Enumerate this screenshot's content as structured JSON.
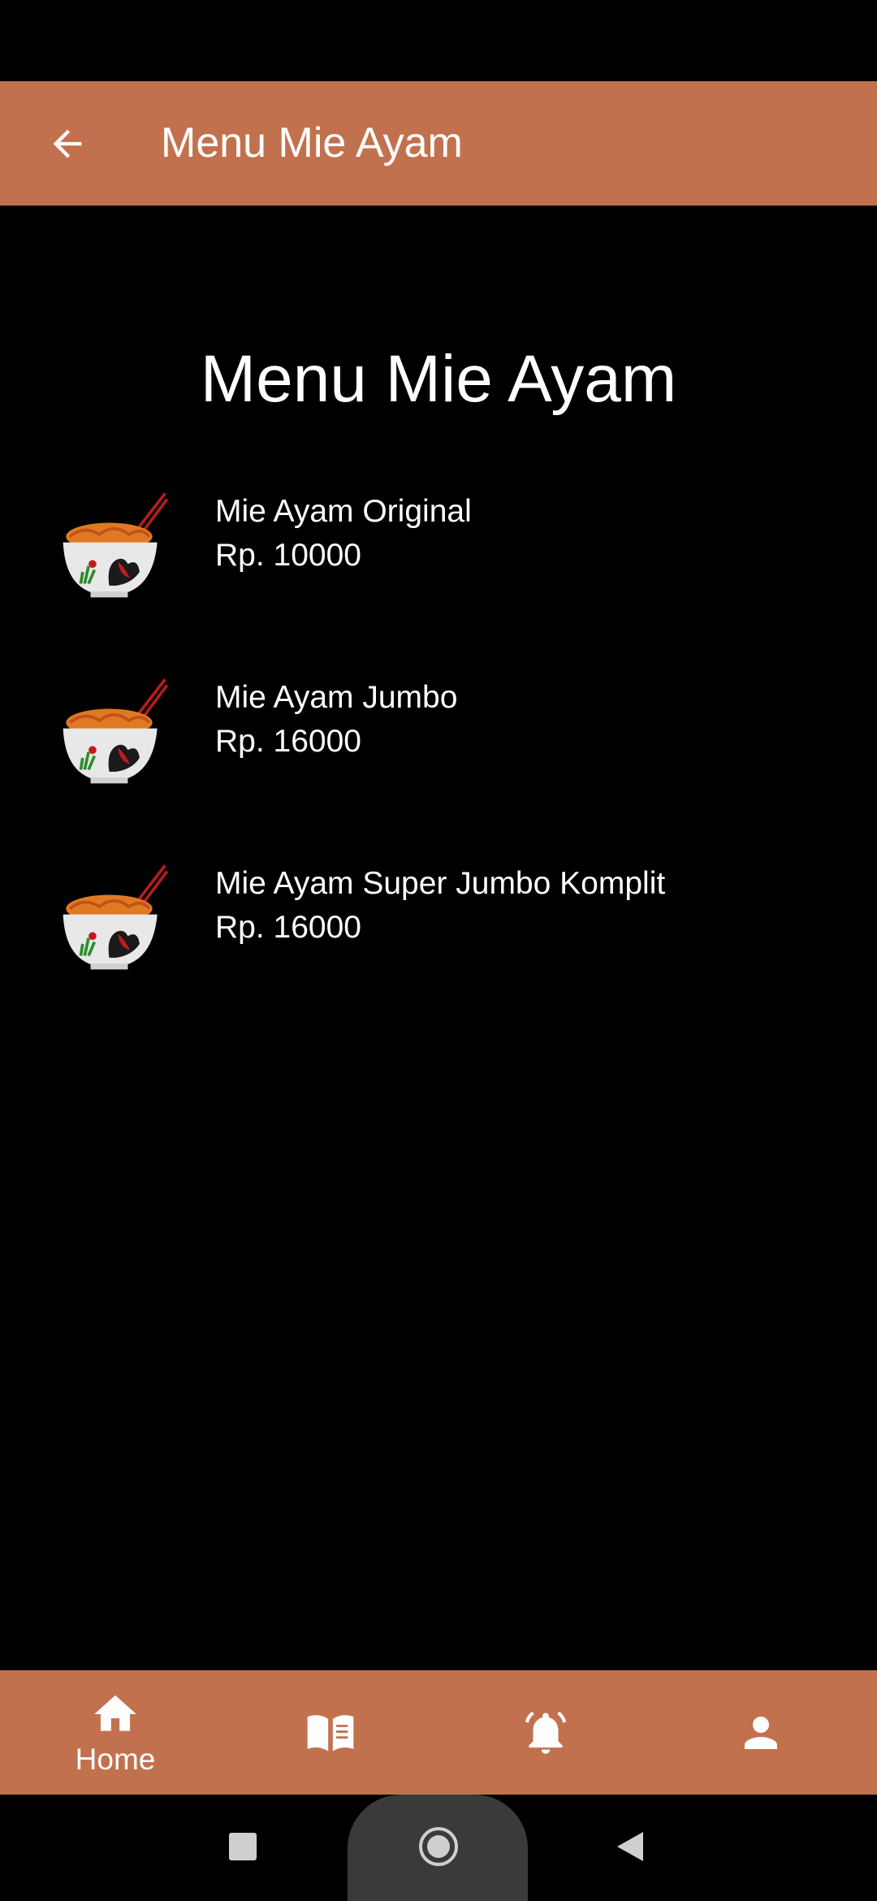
{
  "app_bar": {
    "title": "Menu Mie Ayam"
  },
  "page": {
    "heading": "Menu Mie Ayam"
  },
  "menu_items": [
    {
      "name": "Mie Ayam Original",
      "price": "Rp. 10000"
    },
    {
      "name": "Mie Ayam Jumbo",
      "price": "Rp. 16000"
    },
    {
      "name": "Mie Ayam Super Jumbo Komplit",
      "price": "Rp. 16000"
    }
  ],
  "bottom_nav": {
    "items": [
      {
        "icon": "home-icon",
        "label": "Home"
      },
      {
        "icon": "book-icon",
        "label": ""
      },
      {
        "icon": "bell-icon",
        "label": ""
      },
      {
        "icon": "person-icon",
        "label": ""
      }
    ]
  },
  "colors": {
    "accent": "#c2714e",
    "background": "#000000",
    "text": "#ffffff"
  }
}
